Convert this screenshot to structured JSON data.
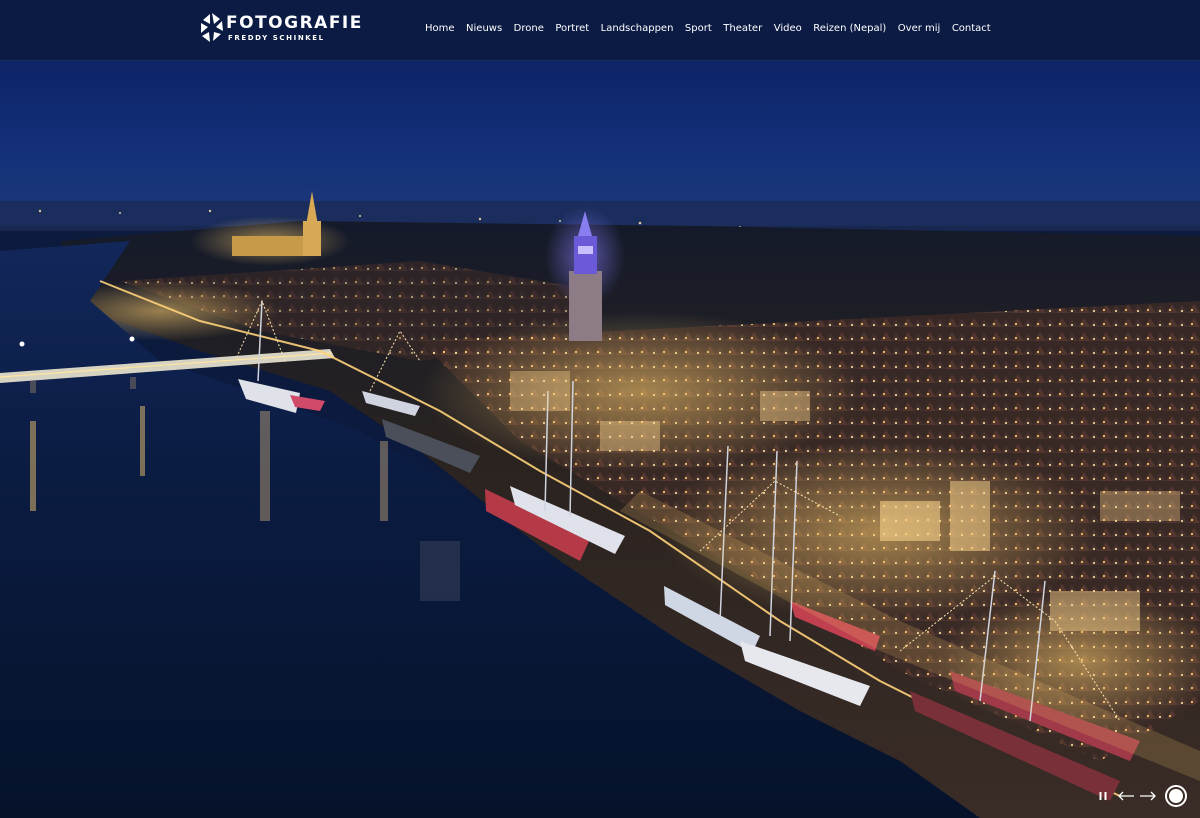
{
  "brand": {
    "title": "FOTOGRAFIE",
    "subtitle": "FREDDY SCHINKEL",
    "logo_icon": "aperture-logo-icon"
  },
  "nav": {
    "items": [
      {
        "label": "Home"
      },
      {
        "label": "Nieuws"
      },
      {
        "label": "Drone"
      },
      {
        "label": "Portret"
      },
      {
        "label": "Landschappen"
      },
      {
        "label": "Sport"
      },
      {
        "label": "Theater"
      },
      {
        "label": "Video"
      },
      {
        "label": "Reizen (Nepal)"
      },
      {
        "label": "Over mij"
      },
      {
        "label": "Contact"
      }
    ]
  },
  "slider": {
    "pause_icon": "pause-icon",
    "prev_icon": "arrow-left-icon",
    "next_icon": "arrow-right-icon",
    "indicator_icon": "slide-dot-icon"
  },
  "colors": {
    "header_bg": "#0c1b44",
    "sky_top": "#0e2a6e",
    "sky_horizon": "#1d3a7a",
    "water": "#0a1a38",
    "city_lights": "#ffd27a"
  }
}
